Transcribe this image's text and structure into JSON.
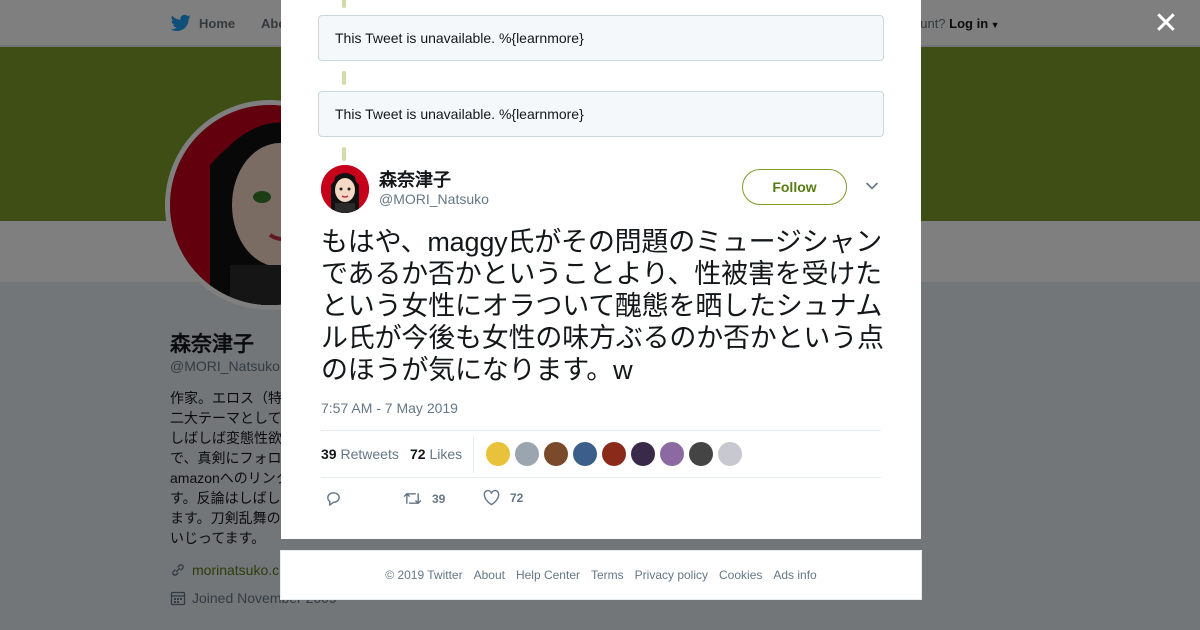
{
  "nav": {
    "home_label": "Home",
    "about_label": "Abo",
    "account_prompt": "ccount?",
    "login_label": "Log in"
  },
  "profile": {
    "name": "森奈津子",
    "handle": "@MORI_Natsuko",
    "bio": "作家。エロス（特\n二大テーマとして\nしばしば変態性欲\nで、真剣にフォロ\namazonへのリンク\nす。反論はしばし\nます。刀剣乱舞の\nいじってます。",
    "link": "morinatsuko.c",
    "joined": "Joined November 2009"
  },
  "modal": {
    "unavailable_text": "This Tweet is unavailable. %{learnmore}",
    "tweet": {
      "name": "森奈津子",
      "handle": "@MORI_Natsuko",
      "follow_label": "Follow",
      "text": "もはや、maggy氏がその問題のミュージシャンであるか否かということより、性被害を受けたという女性にオラついて醜態を晒したシュナムル氏が今後も女性の味方ぶるのか否かという点のほうが気になります。w",
      "timestamp": "7:57 AM - 7 May 2019",
      "retweets_count": "39",
      "retweets_label": "Retweets",
      "likes_count": "72",
      "likes_label": "Likes",
      "action_retweet_count": "39",
      "action_like_count": "72",
      "liker_colors": [
        "#e8c23a",
        "#9aa5b0",
        "#7a4a2a",
        "#3b5f8a",
        "#8a2a1a",
        "#3a2a4a",
        "#8a6aa0",
        "#444444",
        "#c8c8d0"
      ]
    }
  },
  "footer": {
    "copyright": "© 2019 Twitter",
    "links": [
      "About",
      "Help Center",
      "Terms",
      "Privacy policy",
      "Cookies",
      "Ads info"
    ]
  },
  "colors": {
    "accent": "#7d9d2a",
    "accent_dark": "#5a7a16",
    "twitter_blue": "#1da1f2"
  },
  "icons": [
    "twitter-bird-icon",
    "close-icon",
    "chevron-down-icon",
    "reply-icon",
    "retweet-icon",
    "heart-icon",
    "link-icon",
    "calendar-icon"
  ]
}
